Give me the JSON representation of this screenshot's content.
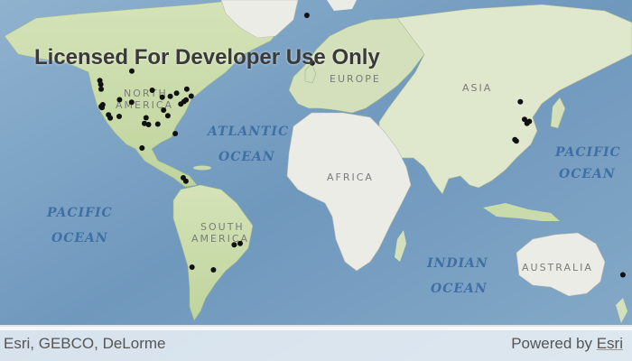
{
  "map": {
    "watermark": "Licensed For Developer Use Only",
    "attribution": "Esri, GEBCO, DeLorme",
    "powered_by": "Powered by",
    "powered_link": "Esri",
    "colors": {
      "ocean": "#7fa3c2",
      "land_green": "#c9dbab",
      "land_light": "#ecece6",
      "marker": "#111111",
      "ocean_label": "#3f6fa5"
    },
    "labels": {
      "north_america": [
        "NORTH",
        "AMERICA"
      ],
      "europe": "EUROPE",
      "asia": "ASIA",
      "africa": "AFRICA",
      "south_america": [
        "SOUTH",
        "AMERICA"
      ],
      "australia": "AUSTRALIA",
      "atlantic": [
        "ATLANTIC",
        "OCEAN"
      ],
      "pacific_west": [
        "PACIFIC",
        "OCEAN"
      ],
      "pacific_east": [
        "PACIFIC",
        "OCEAN"
      ],
      "indian": [
        "INDIAN",
        "OCEAN"
      ]
    },
    "markers": [
      {
        "lon": -123.1,
        "lat": 49.3
      },
      {
        "lon": -122.6,
        "lat": 47.6
      },
      {
        "lon": -122.4,
        "lat": 45.5
      },
      {
        "lon": -122.4,
        "lat": 37.8
      },
      {
        "lon": -121.9,
        "lat": 37.3
      },
      {
        "lon": -118.2,
        "lat": 34.1
      },
      {
        "lon": -117.2,
        "lat": 32.7
      },
      {
        "lon": -121.5,
        "lat": 38.6
      },
      {
        "lon": -111.9,
        "lat": 40.8
      },
      {
        "lon": -112.1,
        "lat": 33.4
      },
      {
        "lon": -105.0,
        "lat": 39.7
      },
      {
        "lon": -96.8,
        "lat": 32.8
      },
      {
        "lon": -95.4,
        "lat": 29.8
      },
      {
        "lon": -97.7,
        "lat": 30.3
      },
      {
        "lon": -93.3,
        "lat": 45.0
      },
      {
        "lon": -87.6,
        "lat": 41.9
      },
      {
        "lon": -83.0,
        "lat": 42.3
      },
      {
        "lon": -84.4,
        "lat": 33.7
      },
      {
        "lon": -80.2,
        "lat": 25.8
      },
      {
        "lon": -77.0,
        "lat": 38.9
      },
      {
        "lon": -75.2,
        "lat": 40.0
      },
      {
        "lon": -74.0,
        "lat": 40.7
      },
      {
        "lon": -71.1,
        "lat": 42.4
      },
      {
        "lon": -79.4,
        "lat": 43.7
      },
      {
        "lon": -73.6,
        "lat": 45.5
      },
      {
        "lon": -90.1,
        "lat": 30.0
      },
      {
        "lon": -86.8,
        "lat": 36.2
      },
      {
        "lon": -99.1,
        "lat": 19.4
      },
      {
        "lon": -104.9,
        "lat": 53.5
      },
      {
        "lon": -75.6,
        "lat": 6.2
      },
      {
        "lon": -74.1,
        "lat": 4.7
      },
      {
        "lon": -43.2,
        "lat": -22.9
      },
      {
        "lon": -46.6,
        "lat": -23.5
      },
      {
        "lon": -58.4,
        "lat": -34.6
      },
      {
        "lon": -70.6,
        "lat": -33.4
      },
      {
        "lon": -2.1,
        "lat": 57.1
      },
      {
        "lon": -5.2,
        "lat": 78.2
      },
      {
        "lon": 121.5,
        "lat": 31.2
      },
      {
        "lon": 120.2,
        "lat": 30.3
      },
      {
        "lon": 118.8,
        "lat": 32.1
      },
      {
        "lon": 114.1,
        "lat": 22.5
      },
      {
        "lon": 113.3,
        "lat": 23.1
      },
      {
        "lon": 116.4,
        "lat": 39.9
      },
      {
        "lon": 174.8,
        "lat": -36.8
      }
    ]
  }
}
